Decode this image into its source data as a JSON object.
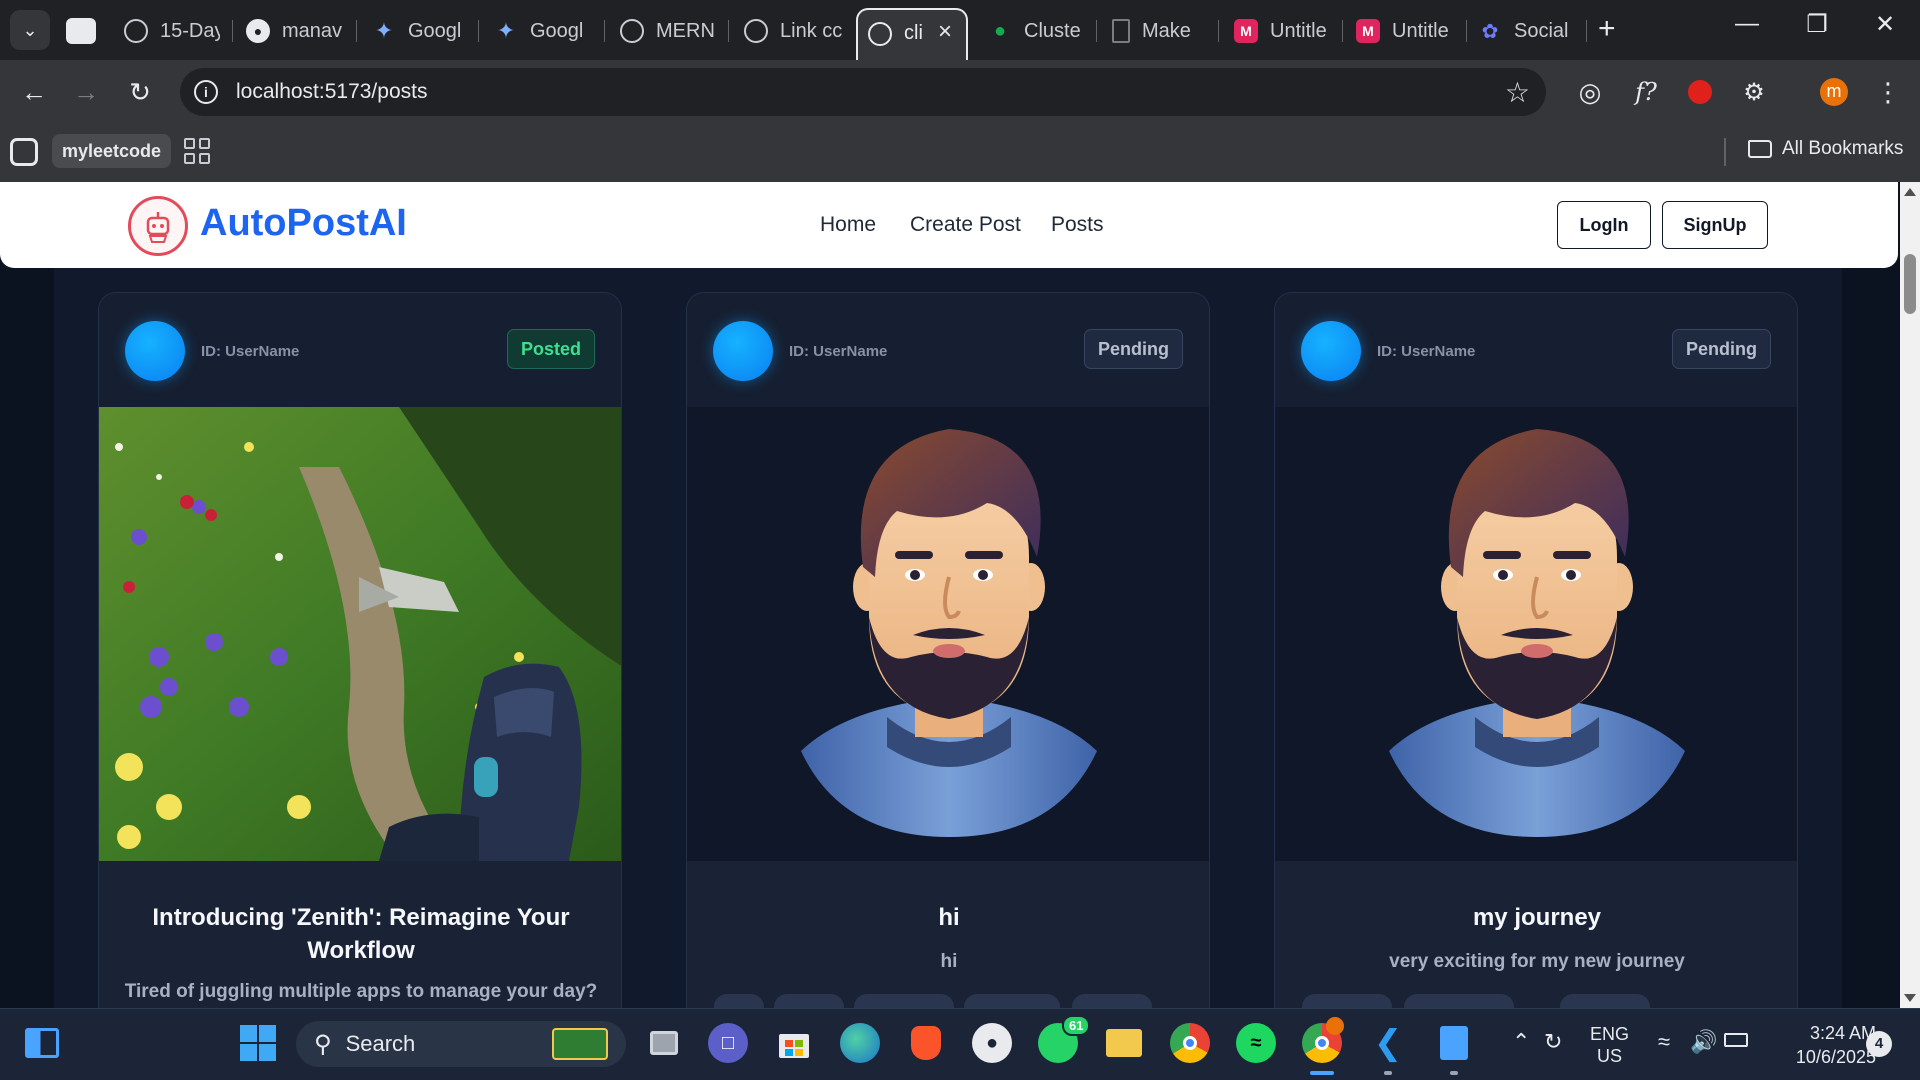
{
  "browser": {
    "tabs": [
      {
        "label": "15-Day",
        "icon": "globe-icon"
      },
      {
        "label": "manav",
        "icon": "github-icon"
      },
      {
        "label": "Googl",
        "icon": "gemini-icon"
      },
      {
        "label": "Googl",
        "icon": "gemini-icon"
      },
      {
        "label": "MERN",
        "icon": "openai-icon"
      },
      {
        "label": "Link cc",
        "icon": "openai-icon"
      },
      {
        "label": "cli",
        "icon": "globe-icon",
        "active": true
      },
      {
        "label": "Cluste",
        "icon": "mongodb-leaf-icon"
      },
      {
        "label": "Make",
        "icon": "document-icon"
      },
      {
        "label": "Untitle",
        "icon": "miro-icon"
      },
      {
        "label": "Untitle",
        "icon": "miro-icon"
      },
      {
        "label": "Social",
        "icon": "social-app-icon"
      }
    ],
    "url": "localhost:5173/posts",
    "profile_initial": "m",
    "bookmarks": {
      "myleetcode": "myleetcode",
      "all": "All Bookmarks"
    }
  },
  "app": {
    "brand": "AutoPostAI",
    "nav": [
      "Home",
      "Create Post",
      "Posts"
    ],
    "login": "LogIn",
    "signup": "SignUp",
    "accent": "#1d64f0"
  },
  "posts": [
    {
      "user": "ID: UserName",
      "status": "Posted",
      "title": "Introducing 'Zenith': Reimagine Your Workflow",
      "description": "Tired of juggling multiple apps to manage your day?",
      "media": "mountain-trail-photo"
    },
    {
      "user": "ID: UserName",
      "status": "Pending",
      "title": "hi",
      "description": "hi",
      "media": "bearded-man-avatar-illustration"
    },
    {
      "user": "ID: UserName",
      "status": "Pending",
      "title": "my journey",
      "description": "very exciting for my new journey",
      "media": "bearded-man-avatar-illustration"
    }
  ],
  "taskbar": {
    "search": "Search",
    "whatsapp_badge": "61",
    "language": "ENG",
    "region": "US",
    "time": "3:24 AM",
    "date": "10/6/2025",
    "notifications": "4"
  }
}
